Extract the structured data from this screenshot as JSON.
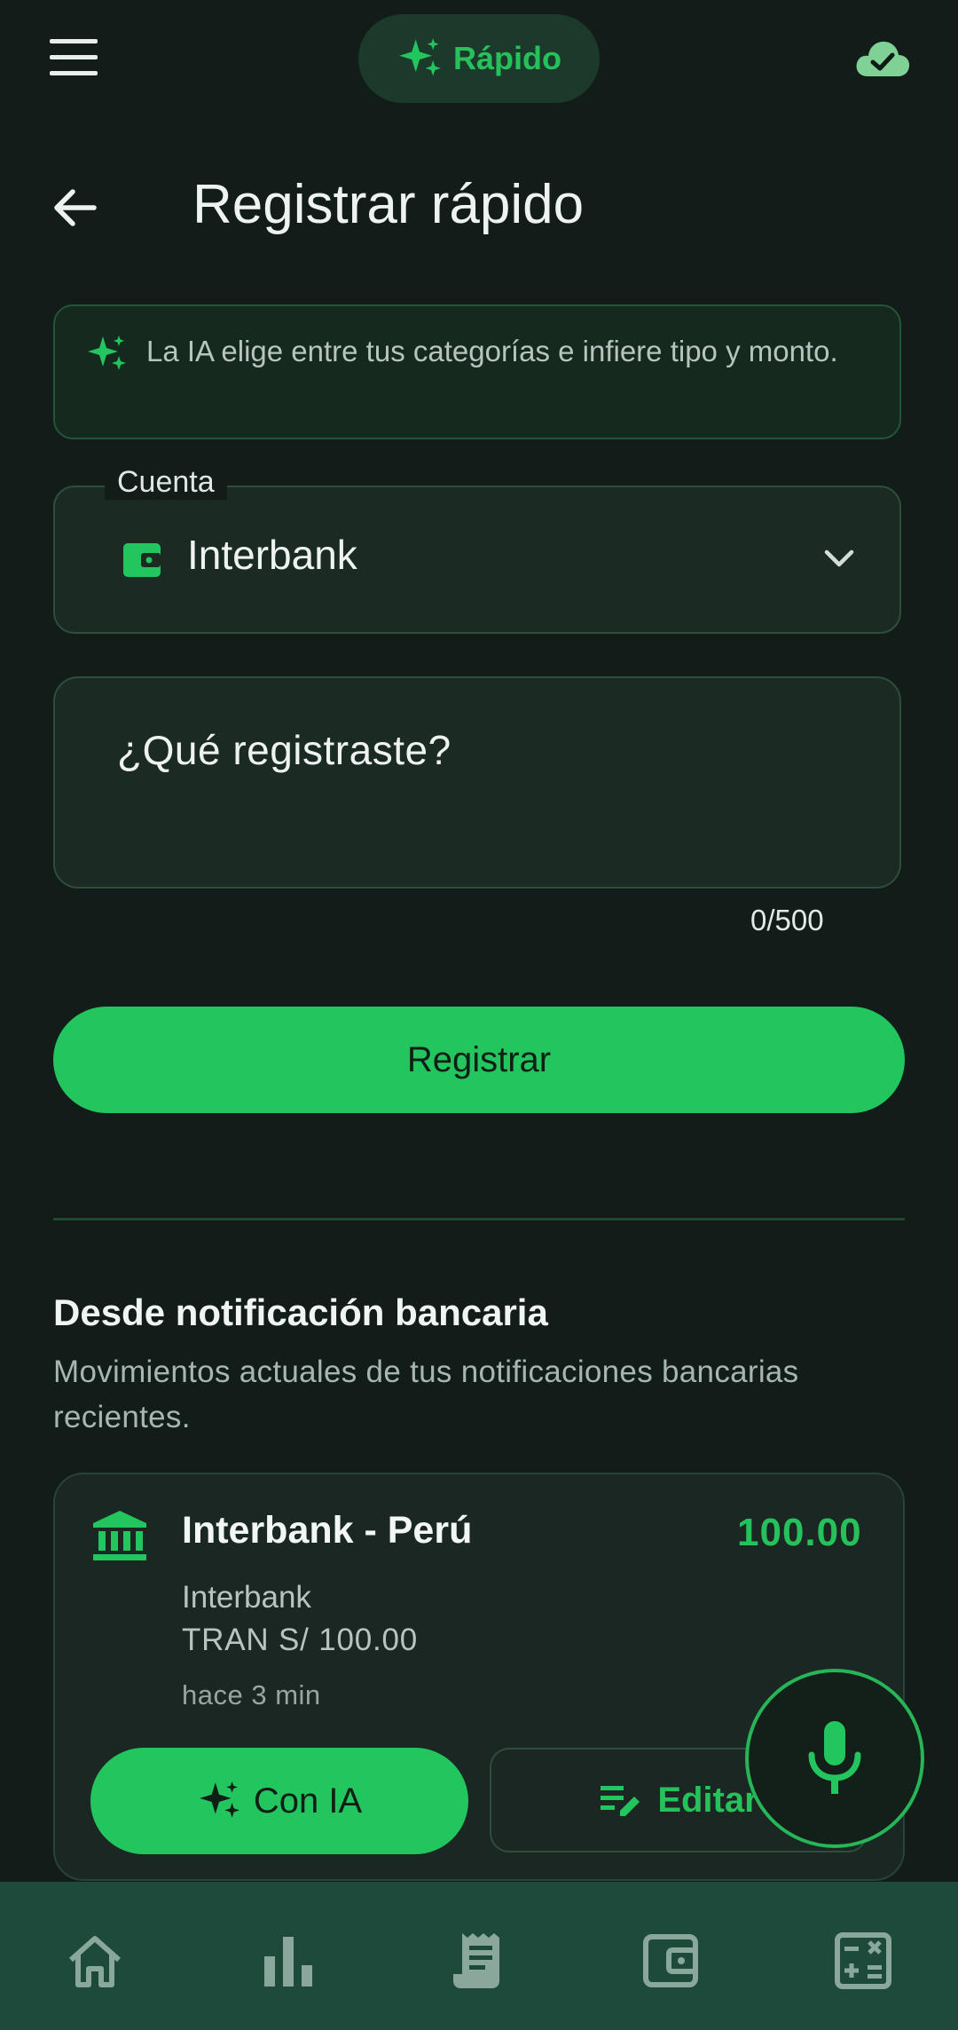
{
  "topbar": {
    "mode_label": "Rápido"
  },
  "page": {
    "title": "Registrar rápido"
  },
  "info": {
    "text": "La IA elige entre tus categorías e infiere tipo y monto."
  },
  "account": {
    "label": "Cuenta",
    "value": "Interbank"
  },
  "entry": {
    "placeholder": "¿Qué registraste?",
    "counter": "0/500"
  },
  "register_button": "Registrar",
  "notifications": {
    "title": "Desde notificación bancaria",
    "description": "Movimientos actuales de tus notificaciones bancarias recientes.",
    "card": {
      "title": "Interbank - Perú",
      "amount": "100.00",
      "line1": "Interbank",
      "line2": "TRAN S/ 100.00",
      "time": "hace 3 min",
      "ai_button": "Con IA",
      "edit_button": "Editar"
    }
  },
  "icons": [
    "menu-icon",
    "sparkle-icon",
    "cloud-check-icon",
    "back-arrow-icon",
    "wallet-icon",
    "chevron-down-icon",
    "bank-icon",
    "edit-note-icon",
    "mic-icon",
    "home-icon",
    "chart-icon",
    "receipt-icon",
    "wallet-nav-icon",
    "calculator-icon"
  ],
  "colors": {
    "accent": "#22c55e",
    "background": "#121c19",
    "nav": "#1e4a3b"
  }
}
